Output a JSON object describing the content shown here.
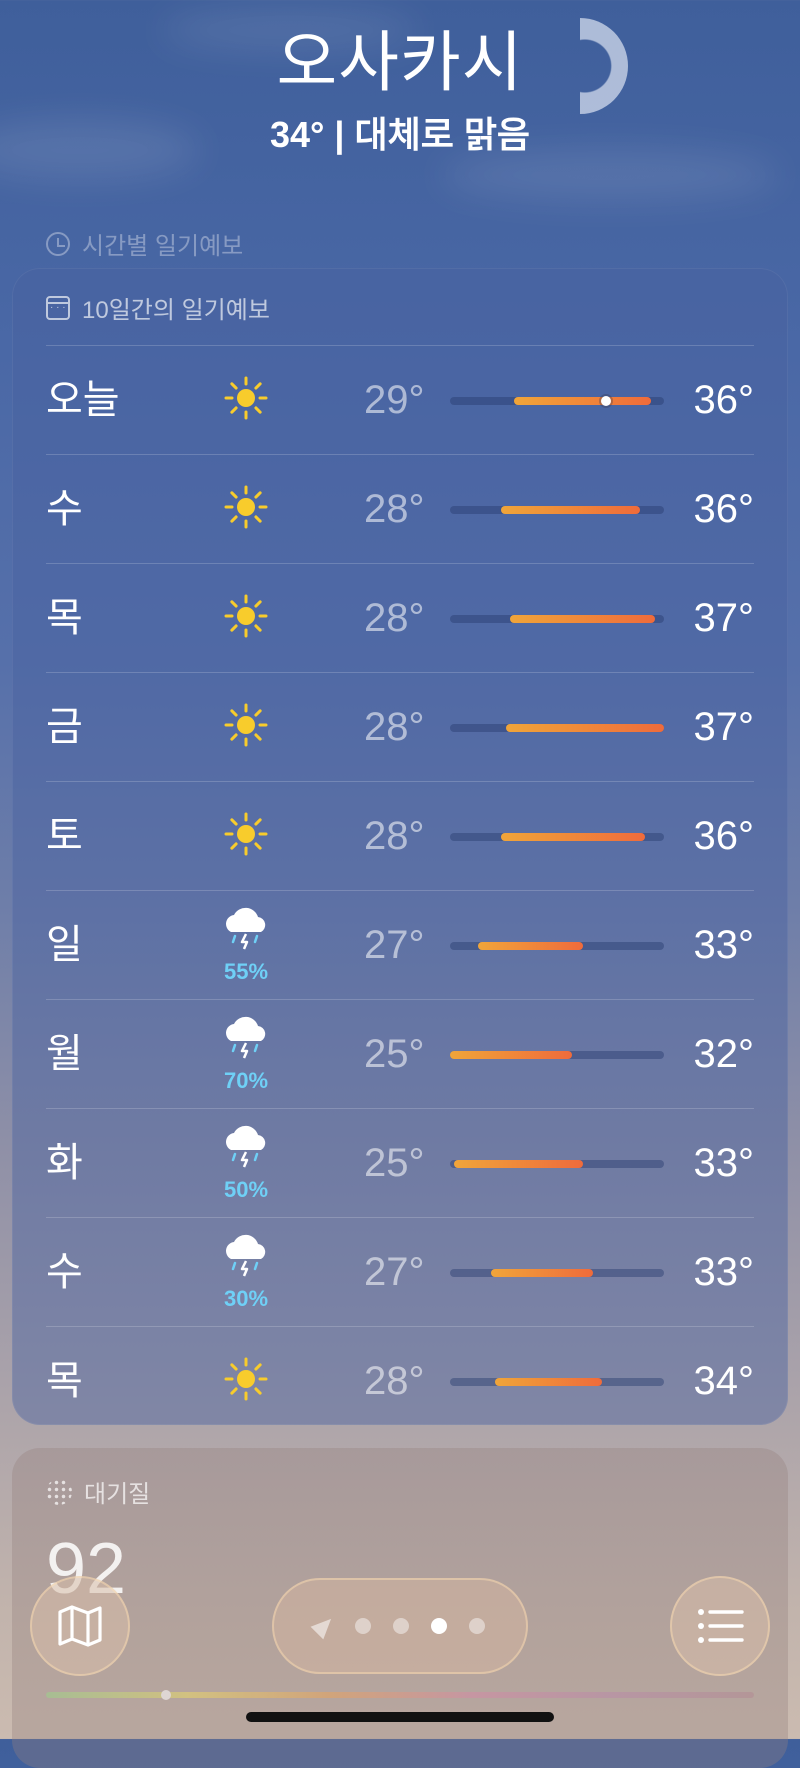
{
  "header": {
    "city": "오사카시",
    "summary": "34° | 대체로 맑음"
  },
  "hourly_section": {
    "title": "시간별 일기예보",
    "icon": "clock-icon"
  },
  "forecast": {
    "title": "10일간의 일기예보",
    "icon": "calendar-icon",
    "days": [
      {
        "day": "오늘",
        "icon": "sun-icon",
        "precip": "",
        "low": "29°",
        "high": "36°",
        "bar_start": 0.3,
        "bar_end": 0.94,
        "current": 0.73
      },
      {
        "day": "수",
        "icon": "sun-icon",
        "precip": "",
        "low": "28°",
        "high": "36°",
        "bar_start": 0.24,
        "bar_end": 0.89
      },
      {
        "day": "목",
        "icon": "sun-icon",
        "precip": "",
        "low": "28°",
        "high": "37°",
        "bar_start": 0.28,
        "bar_end": 0.96
      },
      {
        "day": "금",
        "icon": "sun-icon",
        "precip": "",
        "low": "28°",
        "high": "37°",
        "bar_start": 0.26,
        "bar_end": 1.0
      },
      {
        "day": "토",
        "icon": "sun-icon",
        "precip": "",
        "low": "28°",
        "high": "36°",
        "bar_start": 0.24,
        "bar_end": 0.91
      },
      {
        "day": "일",
        "icon": "thunderstorm-icon",
        "precip": "55%",
        "low": "27°",
        "high": "33°",
        "bar_start": 0.13,
        "bar_end": 0.62
      },
      {
        "day": "월",
        "icon": "thunderstorm-icon",
        "precip": "70%",
        "low": "25°",
        "high": "32°",
        "bar_start": 0.0,
        "bar_end": 0.57
      },
      {
        "day": "화",
        "icon": "thunderstorm-icon",
        "precip": "50%",
        "low": "25°",
        "high": "33°",
        "bar_start": 0.02,
        "bar_end": 0.62
      },
      {
        "day": "수",
        "icon": "thunderstorm-icon",
        "precip": "30%",
        "low": "27°",
        "high": "33°",
        "bar_start": 0.19,
        "bar_end": 0.67
      },
      {
        "day": "목",
        "icon": "sun-icon",
        "precip": "",
        "low": "28°",
        "high": "34°",
        "bar_start": 0.21,
        "bar_end": 0.71
      }
    ]
  },
  "air_quality": {
    "title": "대기질",
    "value": "92",
    "indicator": 0.17
  },
  "bottom_bar": {
    "pages": 4,
    "active_page": 3
  }
}
